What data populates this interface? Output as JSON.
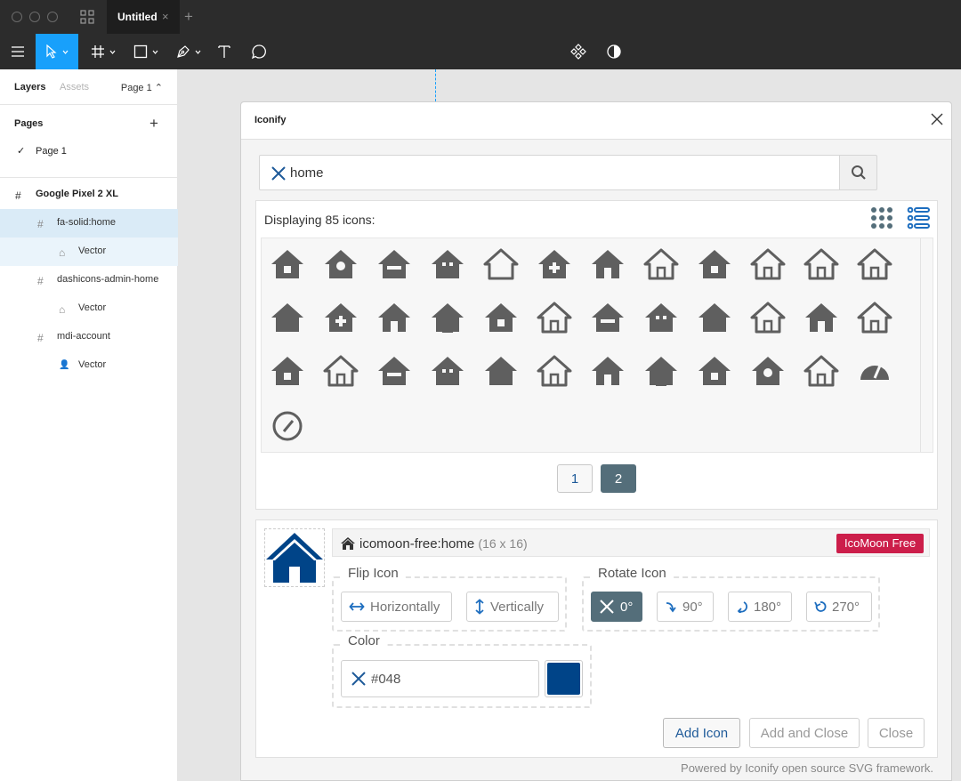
{
  "window": {
    "tab_title": "Untitled",
    "tab_close": "×",
    "new_tab": "+"
  },
  "left_panel": {
    "tabs": {
      "layers": "Layers",
      "assets": "Assets"
    },
    "page_selector": "Page 1 ⌃",
    "pages_title": "Pages",
    "add_page": "+",
    "pages": [
      {
        "label": "Page 1",
        "check": "✓"
      }
    ],
    "layers": [
      {
        "label": "Google Pixel 2 XL",
        "icon": "#",
        "kind": "frame-top"
      },
      {
        "label": "fa-solid:home",
        "icon": "#",
        "kind": "frame-selected"
      },
      {
        "label": "Vector",
        "icon": "⌂",
        "kind": "vector-hover"
      },
      {
        "label": "dashicons-admin-home",
        "icon": "#",
        "kind": "frame"
      },
      {
        "label": "Vector",
        "icon": "⌂",
        "kind": "vector"
      },
      {
        "label": "mdi-account",
        "icon": "#",
        "kind": "frame"
      },
      {
        "label": "Vector",
        "icon": "👤",
        "kind": "vector"
      }
    ]
  },
  "dialog": {
    "title": "Iconify",
    "search_value": "home",
    "results_label": "Displaying 85 icons:",
    "pages": [
      "1",
      "2"
    ],
    "current_page": "2",
    "icon_color": "#5f5f5f",
    "icon_names": [
      "home-lock-icon",
      "home-map-marker-icon",
      "home-minus-icon",
      "home-city-icon",
      "home-outline-icon",
      "home-plus-icon",
      "home-filled-icon",
      "home-variant-outline-icon",
      "shield-home-icon",
      "shield-home-outline-icon",
      "home-thin-outline-icon",
      "home-outline-2-icon",
      "home-solid-icon",
      "home-small-icon",
      "home-upload-icon",
      "home-arrow-icon",
      "home-windows-icon",
      "home-outline-3-icon",
      "home-roof-icon",
      "home-filled-2-icon",
      "home-small-2-icon",
      "home-outline-4-icon",
      "home-door-icon",
      "home-door-outline-icon",
      "home-roof-2-icon",
      "home-roof-outline-icon",
      "home-chimney-icon",
      "home-chimney-2-icon",
      "home-circle-door-icon",
      "home-line-icon",
      "home-solid-2-icon",
      "home-solid-3-icon",
      "home-solid-4-icon",
      "home-chimney-3-icon",
      "home-outline-5-icon",
      "speedometer-icon",
      "speedometer-outline-icon"
    ],
    "selected_icon": {
      "name": "icomoon-free:home",
      "size": "(16 x 16)",
      "license": "IcoMoon Free",
      "color": "#004488"
    },
    "flip": {
      "legend": "Flip Icon",
      "horizontal": "Horizontally",
      "vertical": "Vertically"
    },
    "rotate": {
      "legend": "Rotate Icon",
      "options": [
        "0°",
        "90°",
        "180°",
        "270°"
      ],
      "selected": "0°"
    },
    "color": {
      "legend": "Color",
      "value": "#048"
    },
    "actions": {
      "add": "Add Icon",
      "add_close": "Add and Close",
      "close": "Close"
    },
    "powered": "Powered by Iconify open source SVG framework."
  }
}
